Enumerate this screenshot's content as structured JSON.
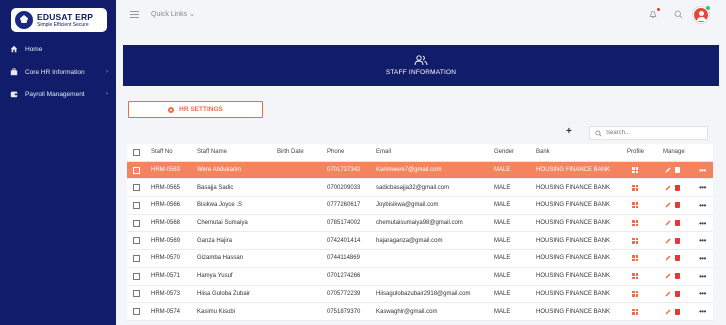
{
  "brand": {
    "name": "EDUSAT ERP",
    "tagline": "Simple Efficient Secure"
  },
  "sidebar": {
    "items": [
      {
        "label": "Home",
        "icon": "home-icon"
      },
      {
        "label": "Core HR Information",
        "icon": "briefcase-icon",
        "expandable": true
      },
      {
        "label": "Payroll Management",
        "icon": "wallet-icon",
        "expandable": true
      }
    ]
  },
  "topbar": {
    "quick_links": "Quick Links"
  },
  "banner": {
    "title": "STAFF INFORMATION",
    "icon": "users-icon"
  },
  "hr_settings_label": "HR SETTINGS",
  "search": {
    "placeholder": "Search..."
  },
  "table": {
    "headers": [
      "Staff No",
      "Staff Name",
      "Birth Date",
      "Phone",
      "Email",
      "Gender",
      "Bank",
      "Profile",
      "Manage"
    ],
    "rows": [
      {
        "staff_no": "HRM-0563",
        "name": "Were Abdukarim",
        "birth": "",
        "phone": "0701737342",
        "email": "Karimwere7@gmail.com",
        "gender": "MALE",
        "bank": "HOUSING FINANCE BANK",
        "selected": true
      },
      {
        "staff_no": "HRM-0565",
        "name": "Basajja Sadic",
        "birth": "",
        "phone": "0700209033",
        "email": "sadicbasajja32@gmail.com",
        "gender": "MALE",
        "bank": "HOUSING FINANCE BANK"
      },
      {
        "staff_no": "HRM-0566",
        "name": "Bisikwa Joyce .S",
        "birth": "",
        "phone": "0777260617",
        "email": "Joybisikwa@gmail.com",
        "gender": "MALE",
        "bank": "HOUSING FINANCE BANK"
      },
      {
        "staff_no": "HRM-0568",
        "name": "Chemutai Sumaiya",
        "birth": "",
        "phone": "0785174002",
        "email": "chemutaisumaiya98@gmail.com",
        "gender": "MALE",
        "bank": "HOUSING FINANCE BANK"
      },
      {
        "staff_no": "HRM-0569",
        "name": "Ganza Hajira",
        "birth": "",
        "phone": "0742401414",
        "email": "hajaraganza@gmail.com",
        "gender": "MALE",
        "bank": "HOUSING FINANCE BANK"
      },
      {
        "staff_no": "HRM-0570",
        "name": "Gizamba Hassan",
        "birth": "",
        "phone": "0744114869",
        "email": "",
        "gender": "MALE",
        "bank": "HOUSING FINANCE BANK"
      },
      {
        "staff_no": "HRM-0571",
        "name": "Hamya Yusuf",
        "birth": "",
        "phone": "0701274266",
        "email": "",
        "gender": "MALE",
        "bank": "HOUSING FINANCE BANK"
      },
      {
        "staff_no": "HRM-0573",
        "name": "Hiisa Guloba Zubair",
        "birth": "",
        "phone": "0705772239",
        "email": "Hiisagulobazubair2918@gmail.com",
        "gender": "MALE",
        "bank": "HOUSING FINANCE BANK"
      },
      {
        "staff_no": "HRM-0574",
        "name": "Kasimu Kisubi",
        "birth": "",
        "phone": "0751879370",
        "email": "Kaswaghir@gmail.com",
        "gender": "MALE",
        "bank": "HOUSING FINANCE BANK"
      }
    ]
  },
  "colors": {
    "navy": "#111d6b",
    "accent": "#ee6b44",
    "selected_row": "#f4845f",
    "delete": "#e53935"
  }
}
